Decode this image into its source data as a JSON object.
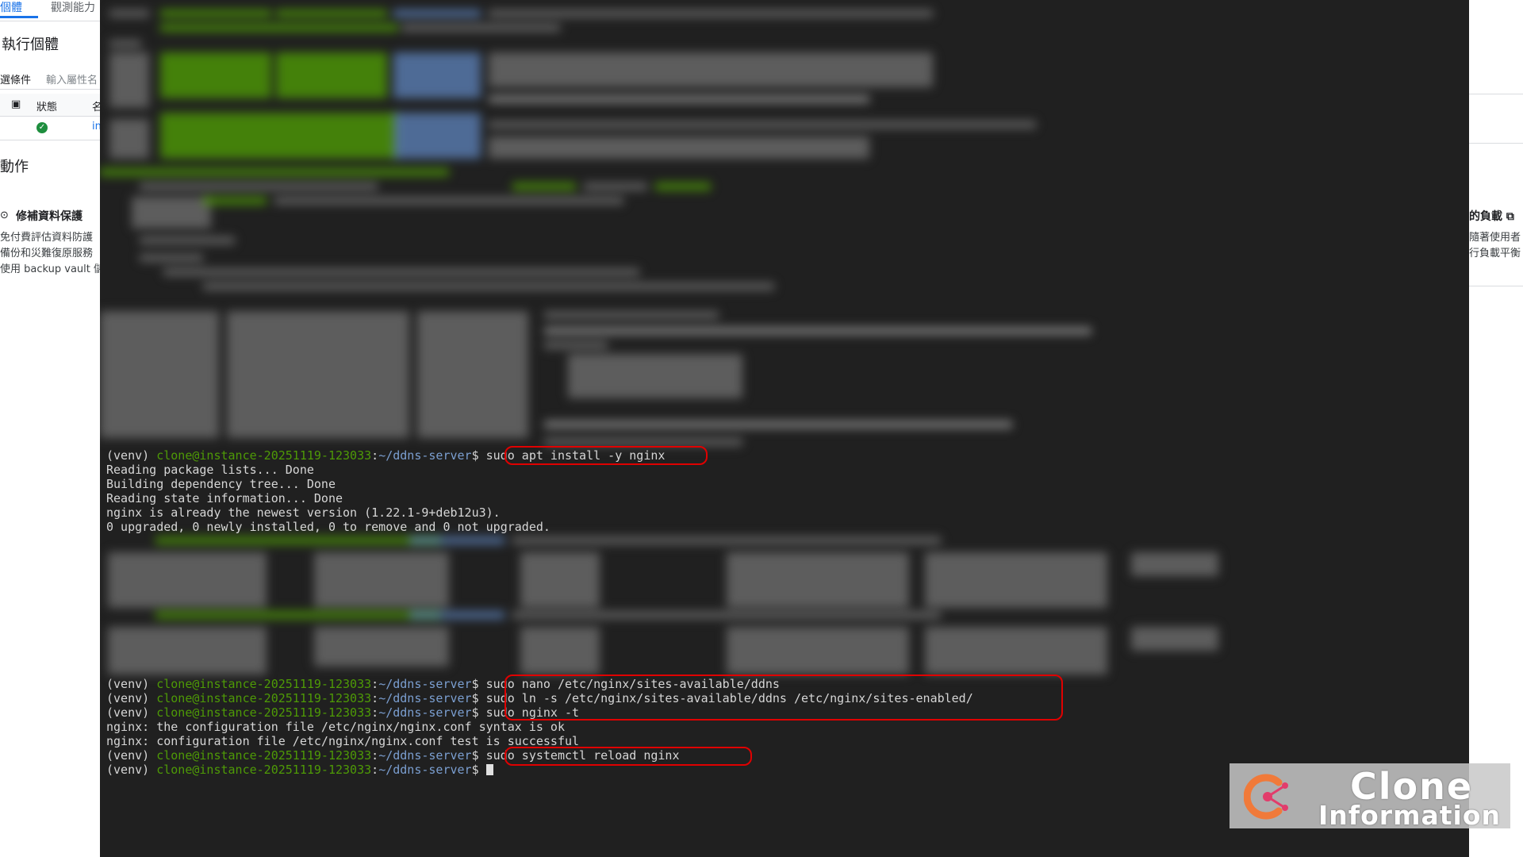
{
  "console": {
    "tabs": [
      "個體",
      "觀測能力"
    ],
    "page_title": "執行個體",
    "filter_label": "選條件",
    "filter_placeholder": "輸入屬性名",
    "table_headers": {
      "status": "狀態",
      "name": "名"
    },
    "row_link": "in",
    "section_title": "動作",
    "card": {
      "title": "修補資料保護",
      "lines": [
        "免付費評估資料防護",
        "備份和災難復原服務",
        "使用 backup vault 儲"
      ]
    },
    "right_card": {
      "title": "的負載",
      "lines": [
        "隨著使用者",
        "行負載平衡"
      ]
    }
  },
  "terminal": {
    "lines": [
      {
        "type": "prompt",
        "venv": "(venv) ",
        "user": "clone@instance-20251119-123033",
        "sep": ":",
        "path": "~/ddns-server",
        "dollar": "$ ",
        "cmd": "sudo apt install -y nginx"
      },
      {
        "type": "output",
        "text": "Reading package lists... Done"
      },
      {
        "type": "output",
        "text": "Building dependency tree... Done"
      },
      {
        "type": "output",
        "text": "Reading state information... Done"
      },
      {
        "type": "output",
        "text": "nginx is already the newest version (1.22.1-9+deb12u3)."
      },
      {
        "type": "output",
        "text": "0 upgraded, 0 newly installed, 0 to remove and 0 not upgraded."
      },
      {
        "type": "prompt",
        "venv": "(venv) ",
        "user": "clone@instance-20251119-123033",
        "sep": ":",
        "path": "~/ddns-server",
        "dollar": "$ ",
        "cmd": "sudo nano /etc/nginx/sites-available/ddns"
      },
      {
        "type": "prompt",
        "venv": "(venv) ",
        "user": "clone@instance-20251119-123033",
        "sep": ":",
        "path": "~/ddns-server",
        "dollar": "$ ",
        "cmd": "sudo ln -s /etc/nginx/sites-available/ddns /etc/nginx/sites-enabled/"
      },
      {
        "type": "prompt",
        "venv": "(venv) ",
        "user": "clone@instance-20251119-123033",
        "sep": ":",
        "path": "~/ddns-server",
        "dollar": "$ ",
        "cmd": "sudo nginx -t"
      },
      {
        "type": "output",
        "text": "nginx: the configuration file /etc/nginx/nginx.conf syntax is ok"
      },
      {
        "type": "output",
        "text": "nginx: configuration file /etc/nginx/nginx.conf test is successful"
      },
      {
        "type": "prompt",
        "venv": "(venv) ",
        "user": "clone@instance-20251119-123033",
        "sep": ":",
        "path": "~/ddns-server",
        "dollar": "$ ",
        "cmd": "sudo systemctl reload nginx"
      },
      {
        "type": "prompt",
        "venv": "(venv) ",
        "user": "clone@instance-20251119-123033",
        "sep": ":",
        "path": "~/ddns-server",
        "dollar": "$ ",
        "cmd": ""
      }
    ]
  },
  "watermark": {
    "line1": "Clone",
    "line2": "Information"
  },
  "colors": {
    "terminal_bg": "#202020",
    "prompt_user": "#4e9a06",
    "prompt_path": "#7b9fd1",
    "highlight": "#e00000",
    "console_link": "#1a73e8",
    "status_ok": "#1e8e3e"
  }
}
